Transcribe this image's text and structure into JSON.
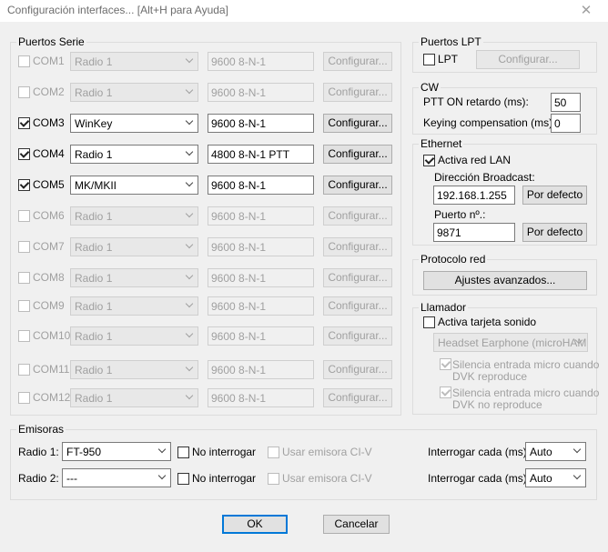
{
  "window": {
    "title": "Configuración interfaces... [Alt+H para Ayuda]",
    "close_glyph": "✕"
  },
  "serial": {
    "group_label": "Puertos Serie",
    "config_label": "Configurar...",
    "ports": [
      {
        "name": "COM1",
        "checked": false,
        "enabled": false,
        "radio": "Radio 1",
        "params": "9600 8-N-1"
      },
      {
        "name": "COM2",
        "checked": false,
        "enabled": false,
        "radio": "Radio 1",
        "params": "9600 8-N-1"
      },
      {
        "name": "COM3",
        "checked": true,
        "enabled": true,
        "radio": "WinKey",
        "params": "9600 8-N-1"
      },
      {
        "name": "COM4",
        "checked": true,
        "enabled": true,
        "radio": "Radio 1",
        "params": "4800 8-N-1 PTT"
      },
      {
        "name": "COM5",
        "checked": true,
        "enabled": true,
        "radio": "MK/MKII",
        "params": "9600 8-N-1"
      },
      {
        "name": "COM6",
        "checked": false,
        "enabled": false,
        "radio": "Radio 1",
        "params": "9600 8-N-1"
      },
      {
        "name": "COM7",
        "checked": false,
        "enabled": false,
        "radio": "Radio 1",
        "params": "9600 8-N-1"
      },
      {
        "name": "COM8",
        "checked": false,
        "enabled": false,
        "radio": "Radio 1",
        "params": "9600 8-N-1"
      },
      {
        "name": "COM9",
        "checked": false,
        "enabled": false,
        "radio": "Radio 1",
        "params": "9600 8-N-1"
      },
      {
        "name": "COM10",
        "checked": false,
        "enabled": false,
        "radio": "Radio 1",
        "params": "9600 8-N-1"
      },
      {
        "name": "COM11",
        "checked": false,
        "enabled": false,
        "radio": "Radio 1",
        "params": "9600 8-N-1"
      },
      {
        "name": "COM12",
        "checked": false,
        "enabled": false,
        "radio": "Radio 1",
        "params": "9600 8-N-1"
      }
    ]
  },
  "lpt": {
    "group_label": "Puertos LPT",
    "checkbox_label": "LPT",
    "config_label": "Configurar..."
  },
  "cw": {
    "group_label": "CW",
    "ptt_label": "PTT ON retardo (ms):",
    "ptt_value": "50",
    "keying_label": "Keying compensation (ms):",
    "keying_value": "0"
  },
  "ethernet": {
    "group_label": "Ethernet",
    "lan_label": "Activa red LAN",
    "broadcast_label": "Dirección Broadcast:",
    "broadcast_value": "192.168.1.255",
    "port_label": "Puerto nº.:",
    "port_value": "9871",
    "default_label": "Por defecto"
  },
  "protocol": {
    "group_label": "Protocolo red",
    "advanced_label": "Ajustes avanzados..."
  },
  "caller": {
    "group_label": "Llamador",
    "soundcard_label": "Activa tarjeta sonido",
    "device_value": "Headset Earphone (microHAM",
    "mute1_line1": "Silencia entrada micro cuando",
    "mute1_line2": "DVK reproduce",
    "mute2_line1": "Silencia entrada micro cuando",
    "mute2_line2": "DVK no reproduce"
  },
  "emisoras": {
    "group_label": "Emisoras",
    "rows": [
      {
        "label": "Radio 1:",
        "radio": "FT-950",
        "no_poll": "No interrogar",
        "civ": "Usar emisora CI-V",
        "poll_label": "Interrogar cada (ms):",
        "poll_value": "Auto"
      },
      {
        "label": "Radio 2:",
        "radio": "---",
        "no_poll": "No interrogar",
        "civ": "Usar emisora CI-V",
        "poll_label": "Interrogar cada (ms):",
        "poll_value": "Auto"
      }
    ]
  },
  "footer": {
    "ok_label": "OK",
    "cancel_label": "Cancelar"
  }
}
